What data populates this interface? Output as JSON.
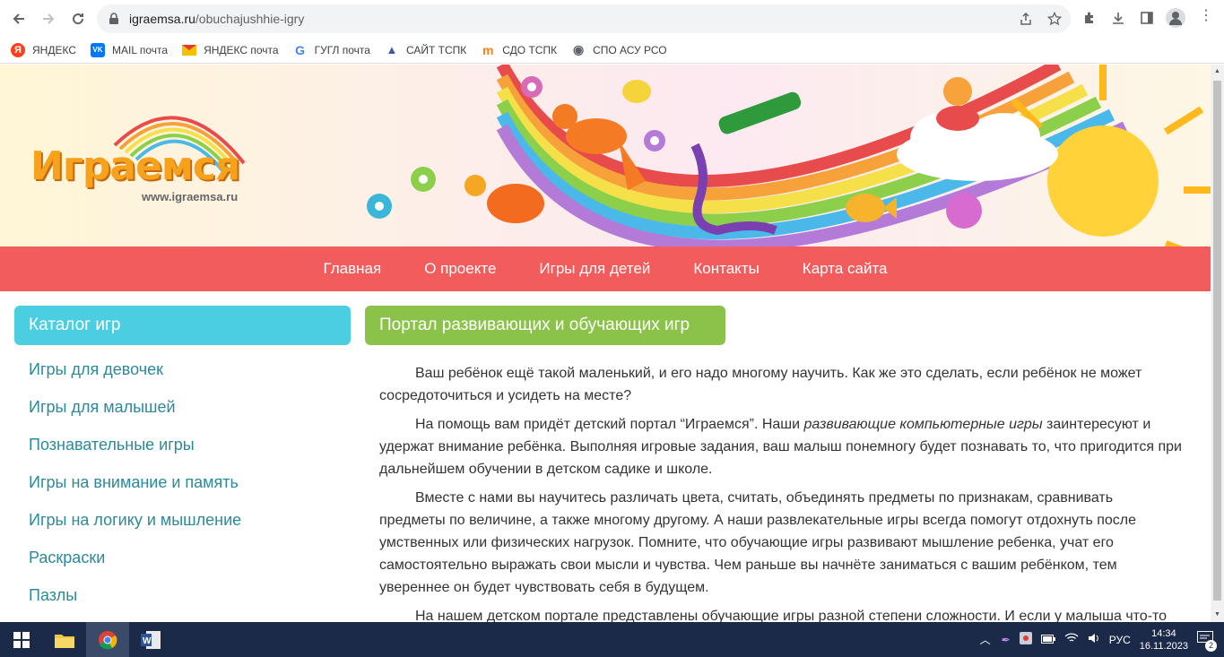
{
  "browser": {
    "url_domain": "igraemsa.ru",
    "url_path": "/obuchajushhie-igry",
    "bookmarks": [
      {
        "label": "ЯНДЕКС",
        "icon": "yandex-icon",
        "color": "#fc3f1d",
        "glyph": "Я"
      },
      {
        "label": "MAIL почта",
        "icon": "vk-icon",
        "color": "#0077ff",
        "glyph": "VK"
      },
      {
        "label": "ЯНДЕКС почта",
        "icon": "mail-envelope-icon",
        "color": "#f5c000",
        "glyph": ""
      },
      {
        "label": "ГУГЛ почта",
        "icon": "google-icon",
        "color": "#4285f4",
        "glyph": "G"
      },
      {
        "label": "САЙТ ТСПК",
        "icon": "tspk-icon",
        "color": "#3b5aa8",
        "glyph": "▲"
      },
      {
        "label": "СДО ТСПК",
        "icon": "moodle-icon",
        "color": "#f98012",
        "glyph": "m"
      },
      {
        "label": "СПО АСУ РСО",
        "icon": "globe-icon",
        "color": "#5f6368",
        "glyph": "◉"
      }
    ]
  },
  "site": {
    "logo_text": "Играемся",
    "logo_url": "www.igraemsa.ru",
    "menu": [
      "Главная",
      "О проекте",
      "Игры для детей",
      "Контакты",
      "Карта сайта"
    ],
    "sidebar_title": "Каталог игр",
    "sidebar_items": [
      "Игры для девочек",
      "Игры для малышей",
      "Познавательные игры",
      "Игры на внимание и память",
      "Игры на логику и мышление",
      "Раскраски",
      "Пазлы"
    ],
    "content_title": "Портал развивающих и обучающих игр",
    "p1": "Ваш ребёнок ещё такой маленький, и его надо многому научить. Как же это сделать, если ребёнок не может сосредоточиться и усидеть на месте?",
    "p2_before": "На помощь вам придёт детский портал “Играемся”. Наши ",
    "p2_italic": "развивающие компьютерные игры",
    "p2_after": " заинтересуют и удержат внимание ребёнка. Выполняя игровые задания, ваш малыш понемногу будет познавать то, что пригодится при дальнейшем обучении в детском садике и школе.",
    "p3": "Вместе с нами вы научитесь различать цвета, считать, объединять предметы по признакам, сравнивать предметы по величине, а также многому другому. А наши развлекательные игры всегда помогут отдохнуть после умственных или физических нагрузок. Помните, что обучающие игры развивают мышление ребенка, учат его самостоятельно выражать свои мысли и чувства. Чем раньше вы начнёте заниматься с вашим ребёнком, тем увереннее он будет чувствовать себя в будущем.",
    "p4": "На нашем детском портале представлены обучающие игры разной степени сложности. И если у малыша что-то"
  },
  "taskbar": {
    "lang": "РУС",
    "time": "14:34",
    "date": "16.11.2023",
    "notif_count": "2"
  }
}
